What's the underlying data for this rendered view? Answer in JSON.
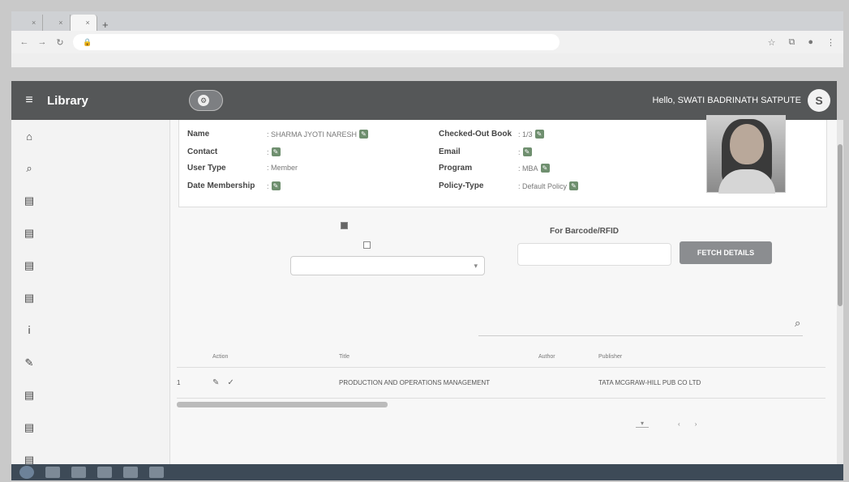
{
  "browser": {
    "tabs": [
      {
        "label": ""
      },
      {
        "label": ""
      },
      {
        "label": ""
      }
    ],
    "url": ""
  },
  "header": {
    "title": "Library",
    "library_pill": "",
    "greeting": "Hello, SWATI BADRINATH SATPUTE",
    "avatar_letter": "S"
  },
  "sidebar": {
    "items": [
      {
        "icon": "home-icon",
        "glyph": "⌂",
        "label": ""
      },
      {
        "icon": "search-icon",
        "glyph": "⌕",
        "label": ""
      },
      {
        "icon": "book-icon",
        "glyph": "▤",
        "label": ""
      },
      {
        "icon": "book-icon",
        "glyph": "▤",
        "label": ""
      },
      {
        "icon": "book-icon",
        "glyph": "▤",
        "label": ""
      },
      {
        "icon": "book-icon",
        "glyph": "▤",
        "label": ""
      },
      {
        "icon": "info-icon",
        "glyph": "ⅰ",
        "label": ""
      },
      {
        "icon": "pen-icon",
        "glyph": "✎",
        "label": ""
      },
      {
        "icon": "book-icon",
        "glyph": "▤",
        "label": ""
      },
      {
        "icon": "book-icon",
        "glyph": "▤",
        "label": ""
      },
      {
        "icon": "book-icon",
        "glyph": "▤",
        "label": ""
      }
    ]
  },
  "member": {
    "name_label": "Name",
    "name_value": ": SHARMA JYOTI NARESH",
    "contact_label": "Contact",
    "contact_value": ":",
    "user_type_label": "User Type",
    "user_type_value": ": Member",
    "membership_label": "Date Membership",
    "membership_value": ":",
    "checked_out_label": "Checked-Out Book",
    "checked_out_value": ": 1/3",
    "email_label": "Email",
    "email_value": ":",
    "program_label": "Program",
    "program_value": ": MBA",
    "policy_label": "Policy-Type",
    "policy_value": ": Default Policy"
  },
  "search_panel": {
    "option1": "",
    "option2": "",
    "select_placeholder": "",
    "barcode_title": "For Barcode/RFID",
    "fetch_button": "FETCH DETAILS"
  },
  "issued": {
    "title": "",
    "search_placeholder": "",
    "columns": [
      "",
      "Action",
      "",
      "Title",
      "Author",
      "Publisher"
    ],
    "rows": [
      {
        "sno": "1",
        "accession": "",
        "title": "PRODUCTION AND OPERATIONS MANAGEMENT",
        "author": "",
        "publisher": "TATA MCGRAW-HILL PUB CO LTD"
      }
    ],
    "pager": {
      "rows_label": "",
      "rows_value": "",
      "range": ""
    }
  },
  "taskbar": {
    "clock": ""
  }
}
